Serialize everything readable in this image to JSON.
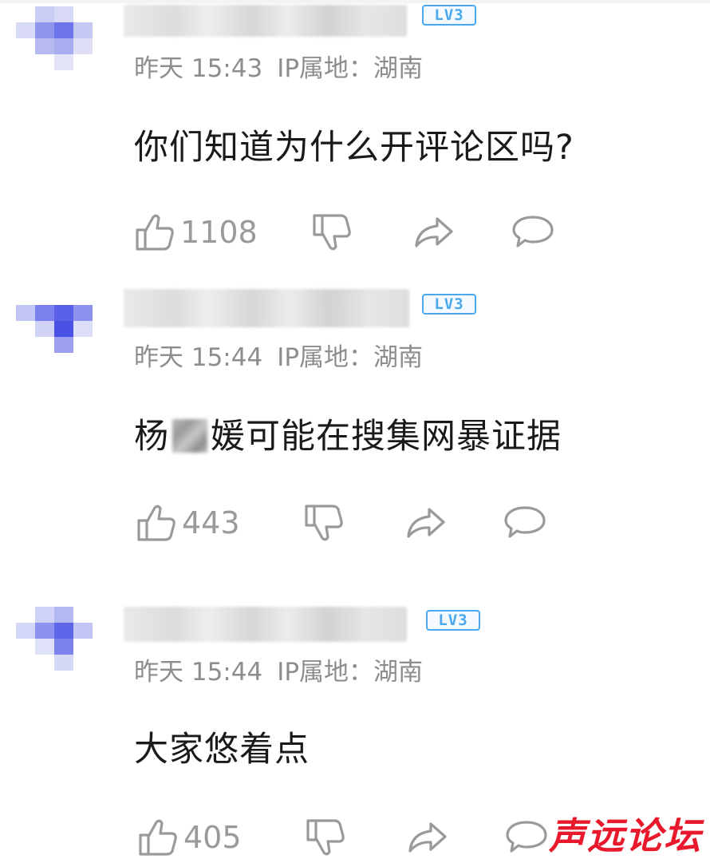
{
  "comments": [
    {
      "level_badge": "LV3",
      "time": "昨天 15:43",
      "ip_label": "IP属地：",
      "ip_region": "湖南",
      "text": "你们知道为什么开评论区吗?",
      "likes": "1108"
    },
    {
      "level_badge": "LV3",
      "time": "昨天 15:44",
      "ip_label": "IP属地：",
      "ip_region": "湖南",
      "text_before_censor": "杨",
      "text_after_censor": "媛可能在搜集网暴证据",
      "likes": "443"
    },
    {
      "level_badge": "LV3",
      "time": "昨天 15:44",
      "ip_label": "IP属地：",
      "ip_region": "湖南",
      "text": "大家悠着点",
      "likes": "405"
    }
  ],
  "icons": [
    "thumbs-up-icon",
    "thumbs-down-icon",
    "share-icon",
    "comment-icon"
  ],
  "colors": {
    "badge_blue": "#4aa8ef",
    "meta_gray": "#8d8d8d",
    "icon_gray": "#9a9a9a",
    "watermark_red": "#e8192c"
  },
  "watermark": "声远论坛"
}
